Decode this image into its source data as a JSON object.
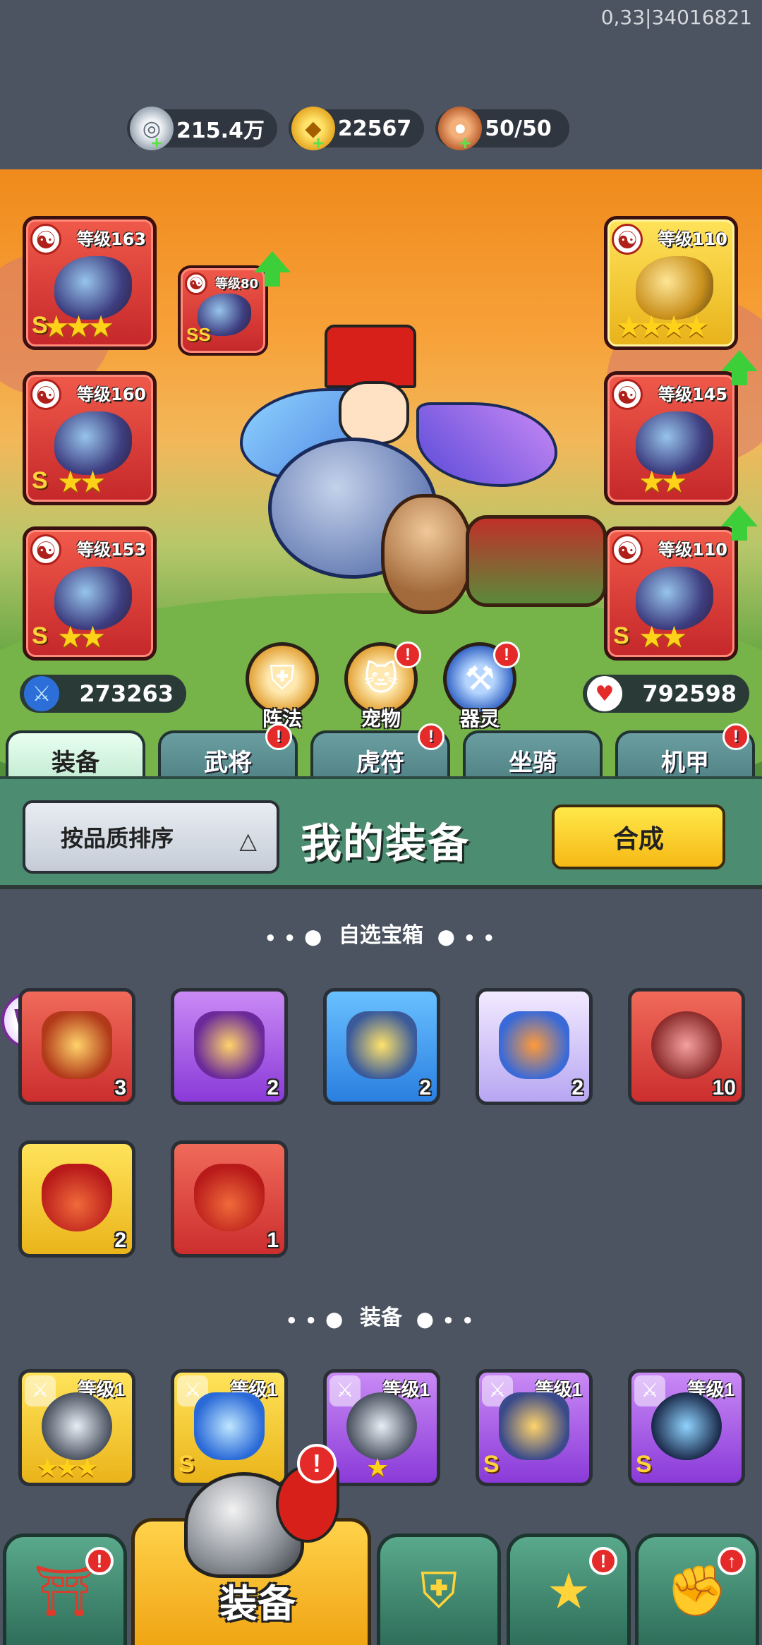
{
  "debug_id": "0,33|34016821",
  "resources": [
    {
      "name": "silver",
      "icon": "silver-coin-icon",
      "value": "215.4万"
    },
    {
      "name": "gold",
      "icon": "gold-ingot-icon",
      "value": "22567"
    },
    {
      "name": "stamina",
      "icon": "meat-icon",
      "value": "50/50"
    }
  ],
  "hero": {
    "left_slots": [
      {
        "level": "等级163",
        "stars": "★★★",
        "rank": "S"
      },
      {
        "level": "等级160",
        "stars": "★★",
        "rank": "S"
      },
      {
        "level": "等级153",
        "stars": "★★",
        "rank": "S"
      }
    ],
    "pet_slot": {
      "level": "等级80",
      "rank": "SS"
    },
    "right_slots": [
      {
        "level": "等级110",
        "stars": "★★★★"
      },
      {
        "level": "等级145",
        "stars": "★★"
      },
      {
        "level": "等级110",
        "stars": "★★",
        "rank": "S"
      }
    ],
    "attack": "273263",
    "hp": "792598",
    "actions": [
      {
        "label": "阵法",
        "icon": "formation-icon",
        "badge": ""
      },
      {
        "label": "宠物",
        "icon": "pet-cat-icon",
        "badge": "!"
      },
      {
        "label": "器灵",
        "icon": "spirit-icon",
        "badge": "!"
      }
    ]
  },
  "tabs": [
    {
      "label": "装备",
      "active": true,
      "badge": ""
    },
    {
      "label": "武将",
      "active": false,
      "badge": "!"
    },
    {
      "label": "虎符",
      "active": false,
      "badge": "!"
    },
    {
      "label": "坐骑",
      "active": false,
      "badge": ""
    },
    {
      "label": "机甲",
      "active": false,
      "badge": "!"
    }
  ],
  "panel": {
    "sort_label": "按品质排序",
    "title": "我的装备",
    "merge_label": "合成"
  },
  "section_chests": "自选宝箱",
  "chests": [
    {
      "color": "red",
      "count": "3"
    },
    {
      "color": "purple",
      "count": "2"
    },
    {
      "color": "blue",
      "count": "2"
    },
    {
      "color": "lav",
      "count": "2"
    },
    {
      "color": "red",
      "count": "10"
    },
    {
      "color": "yellow",
      "count": "2"
    },
    {
      "color": "red",
      "count": "1"
    }
  ],
  "section_equip": "装备",
  "equipment": [
    {
      "color": "yellow",
      "level": "等级1",
      "stars": "★★★",
      "rank": ""
    },
    {
      "color": "yellow",
      "level": "等级1",
      "stars": "",
      "rank": "S"
    },
    {
      "color": "purple",
      "level": "等级1",
      "stars": "★",
      "rank": ""
    },
    {
      "color": "purple",
      "level": "等级1",
      "stars": "",
      "rank": "S"
    },
    {
      "color": "purple",
      "level": "等级1",
      "stars": "",
      "rank": "S"
    }
  ],
  "nav": {
    "main_label": "装备",
    "main_badge": "!",
    "items": [
      {
        "icon": "shop-gate-icon",
        "badge": "!"
      },
      {
        "icon": "battle-shield-icon",
        "badge": ""
      },
      {
        "icon": "stars-wing-icon",
        "badge": "!"
      },
      {
        "icon": "fist-upgrade-icon",
        "badge": "↑"
      }
    ]
  },
  "colors": {
    "accent_green": "#4c8c70",
    "badge_red": "#e52a2a",
    "gold_btn": "#f6b915"
  }
}
